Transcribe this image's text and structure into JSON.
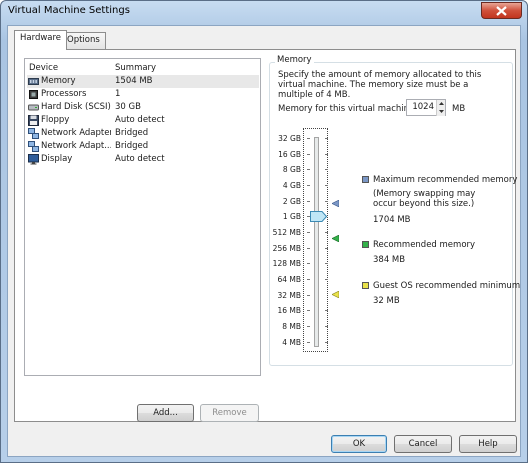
{
  "window": {
    "title": "Virtual Machine Settings",
    "close_icon": "close-icon"
  },
  "tabs": [
    {
      "label": "Hardware",
      "active": true
    },
    {
      "label": "Options",
      "active": false
    }
  ],
  "device_list": {
    "headers": {
      "device": "Device",
      "summary": "Summary"
    },
    "rows": [
      {
        "device": "Memory",
        "summary": "1504 MB",
        "icon": "memory-icon",
        "selected": true
      },
      {
        "device": "Processors",
        "summary": "1",
        "icon": "processor-icon",
        "selected": false
      },
      {
        "device": "Hard Disk (SCSI)",
        "summary": "30 GB",
        "icon": "hard-disk-icon",
        "selected": false
      },
      {
        "device": "Floppy",
        "summary": "Auto detect",
        "icon": "floppy-icon",
        "selected": false
      },
      {
        "device": "Network Adapter",
        "summary": "Bridged",
        "icon": "network-adapter-icon",
        "selected": false
      },
      {
        "device": "Network Adapt...",
        "summary": "Bridged",
        "icon": "network-adapter-icon",
        "selected": false
      },
      {
        "device": "Display",
        "summary": "Auto detect",
        "icon": "display-icon",
        "selected": false
      }
    ]
  },
  "list_buttons": {
    "add": "Add...",
    "remove": "Remove"
  },
  "memory": {
    "group_title": "Memory",
    "description": "Specify the amount of memory allocated to this virtual machine. The memory size must be a multiple of 4 MB.",
    "field_label": "Memory for this virtual machine:",
    "value": "1024",
    "unit": "MB",
    "scale_labels": [
      "32 GB",
      "16 GB",
      "8 GB",
      "4 GB",
      "2 GB",
      "1 GB",
      "512 MB",
      "256 MB",
      "128 MB",
      "64 MB",
      "32 MB",
      "16 MB",
      "8 MB",
      "4 MB"
    ],
    "legend": {
      "maximum": {
        "title": "Maximum recommended memory",
        "note": "(Memory swapping may occur beyond this size.)",
        "value": "1704 MB",
        "color": "#7b97c6"
      },
      "recommended": {
        "title": "Recommended memory",
        "value": "384 MB",
        "color": "#34b14a"
      },
      "minimum": {
        "title": "Guest OS recommended minimum",
        "value": "32 MB",
        "color": "#e9e24a"
      }
    }
  },
  "dialog_buttons": {
    "ok": "OK",
    "cancel": "Cancel",
    "help": "Help"
  }
}
